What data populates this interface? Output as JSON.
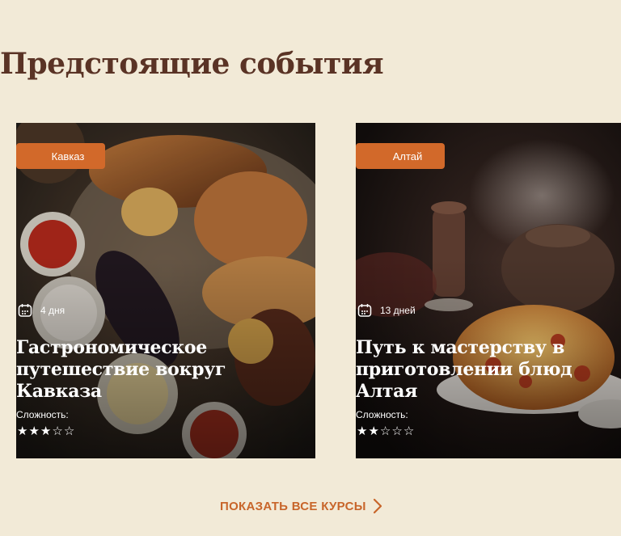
{
  "section": {
    "title": "Предстоящие события"
  },
  "cards": [
    {
      "tag": "Кавказ",
      "duration": "4 дня",
      "title": "Гастрономическое путешествие вокруг Кавказа",
      "difficulty_label": "Сложность:",
      "difficulty": {
        "filled": 3,
        "total": 5
      }
    },
    {
      "tag": "Алтай",
      "duration": "13 дней",
      "title": "Путь к мастерству в приготовлении блюд Алтая",
      "difficulty_label": "Сложность:",
      "difficulty": {
        "filled": 2,
        "total": 5
      }
    }
  ],
  "show_all": {
    "label": "ПОКАЗАТЬ ВСЕ КУРСЫ",
    "icon": "chevron-right-icon"
  },
  "colors": {
    "background": "#f2ead7",
    "title": "#5a3325",
    "accent": "#d2692a"
  }
}
